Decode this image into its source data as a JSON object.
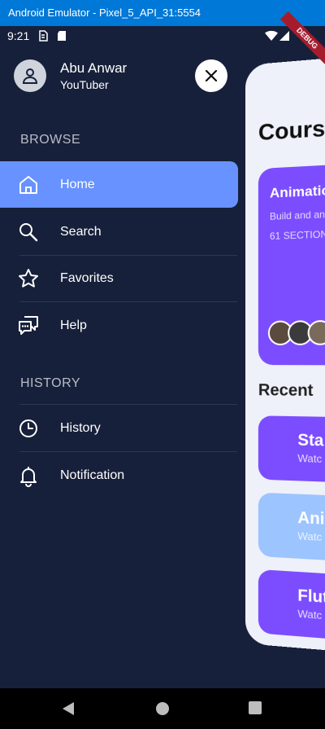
{
  "window": {
    "title": "Android Emulator - Pixel_5_API_31:5554"
  },
  "status_bar": {
    "time": "9:21",
    "debug_ribbon": "DEBUG"
  },
  "profile": {
    "name": "Abu Anwar",
    "role": "YouTuber"
  },
  "sections": {
    "browse": "BROWSE",
    "history": "HISTORY"
  },
  "menu": {
    "home": "Home",
    "search": "Search",
    "favorites": "Favorites",
    "help": "Help",
    "history": "History",
    "notification": "Notification"
  },
  "content": {
    "title": "Cours",
    "course": {
      "title": "Animatio SwiftUI",
      "desc": "Build and an app from scr",
      "sections": "61 SECTION"
    },
    "recent_title": "Recent",
    "recent": [
      {
        "title": "Sta",
        "sub": "Watc",
        "color": "#7c4dff"
      },
      {
        "title": "Anir",
        "sub": "Watc",
        "color": "#9cc4ff"
      },
      {
        "title": "Flutt",
        "sub": "Watc",
        "color": "#7c4dff"
      }
    ]
  },
  "colors": {
    "background": "#17203a",
    "active_item": "#6792ff",
    "title_bar": "#0078d7",
    "card_purple": "#7c4dff"
  }
}
